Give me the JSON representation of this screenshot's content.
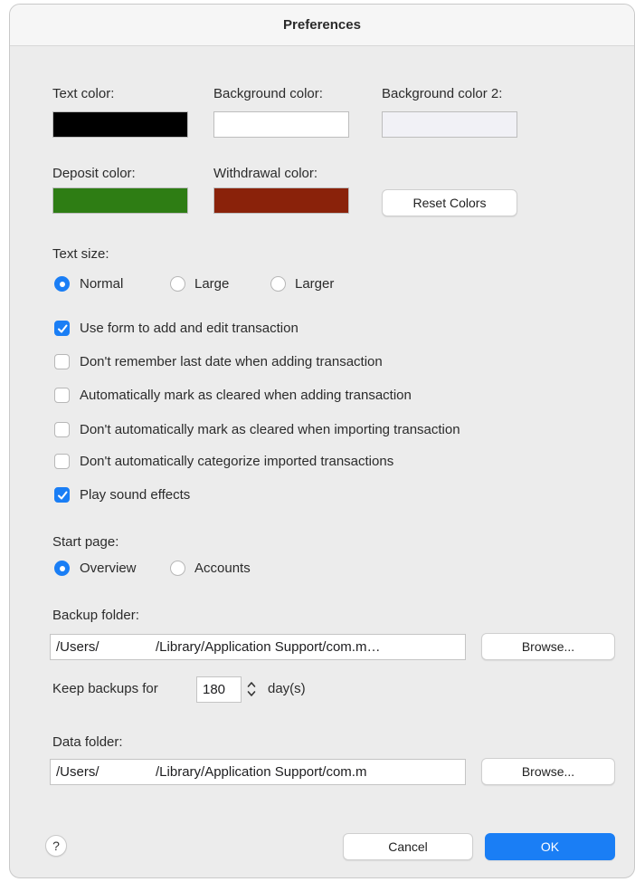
{
  "window": {
    "title": "Preferences"
  },
  "colors": {
    "text_label": "Text color:",
    "text_value": "#000000",
    "background_label": "Background color:",
    "background_value": "#ffffff",
    "background2_label": "Background color 2:",
    "background2_value": "#f1f1f6",
    "deposit_label": "Deposit color:",
    "deposit_value": "#2e7d14",
    "withdrawal_label": "Withdrawal color:",
    "withdrawal_value": "#8a220a",
    "reset_button": "Reset Colors"
  },
  "text_size": {
    "label": "Text size:",
    "options": [
      "Normal",
      "Large",
      "Larger"
    ],
    "selected": "Normal"
  },
  "checkboxes": [
    {
      "label": "Use form to add and edit transaction",
      "checked": true
    },
    {
      "label": "Don't remember last date when adding transaction",
      "checked": false
    },
    {
      "label": "Automatically mark as cleared when adding transaction",
      "checked": false
    },
    {
      "label": "Don't automatically mark as cleared when importing transaction",
      "checked": false
    },
    {
      "label": "Don't automatically categorize imported transactions",
      "checked": false
    },
    {
      "label": "Play sound effects",
      "checked": true
    }
  ],
  "start_page": {
    "label": "Start page:",
    "options": [
      "Overview",
      "Accounts"
    ],
    "selected": "Overview"
  },
  "backup": {
    "label": "Backup folder:",
    "path": "/Users/               /Library/Application Support/com.m…",
    "browse": "Browse...",
    "keep_label": "Keep backups for",
    "keep_value": "180",
    "keep_unit": "day(s)"
  },
  "data_folder": {
    "label": "Data folder:",
    "path": "/Users/               /Library/Application Support/com.m",
    "browse": "Browse..."
  },
  "footer": {
    "help": "?",
    "cancel": "Cancel",
    "ok": "OK"
  },
  "accent_color": "#1a7ef5"
}
